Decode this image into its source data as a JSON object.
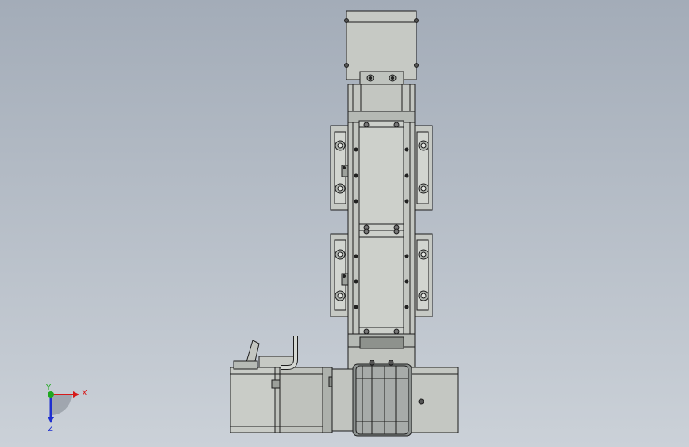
{
  "viewport": {
    "background_top": "#a3acb8",
    "background_bottom": "#cbd1d8"
  },
  "model": {
    "part_fill": "#c9ccc7",
    "part_fill_dark": "#a9ada8",
    "edge_color": "#1c1c1c",
    "motor_fill": "#bfc2bd",
    "bearing_fill": "#8d9290"
  },
  "triad": {
    "x_label": "X",
    "y_label": "Y",
    "z_label": "Z",
    "x_color": "#d61a1a",
    "y_color": "#1fa81f",
    "z_color": "#1e2fd0"
  }
}
